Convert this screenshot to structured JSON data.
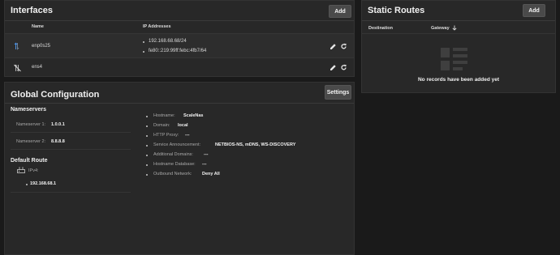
{
  "interfaces": {
    "title": "Interfaces",
    "add_label": "Add",
    "columns": {
      "name": "Name",
      "ip": "IP Addresses"
    },
    "rows": [
      {
        "name": "enp0s25",
        "ips": [
          "192.168.68.68/24",
          "fe80::219:99ff:febc:4fb7/64"
        ]
      },
      {
        "name": "ens4",
        "ips": []
      }
    ]
  },
  "static_routes": {
    "title": "Static Routes",
    "add_label": "Add",
    "columns": {
      "destination": "Destination",
      "gateway": "Gateway"
    },
    "sort_icon": "arrow-down-icon",
    "empty_message": "No records have been added yet"
  },
  "global_config": {
    "title": "Global Configuration",
    "settings_label": "Settings",
    "nameservers": {
      "heading": "Nameservers",
      "items": [
        {
          "label": "Nameserver 1:",
          "value": "1.0.0.1"
        },
        {
          "label": "Nameserver 2:",
          "value": "8.8.8.8"
        }
      ]
    },
    "default_route": {
      "heading": "Default Route",
      "ipv4_label": "IPv4:",
      "ipv4_value": "192.168.68.1"
    },
    "details": [
      {
        "label": "Hostname:",
        "value": "ScaleNas"
      },
      {
        "label": "Domain:",
        "value": "local"
      },
      {
        "label": "HTTP Proxy:",
        "value": "---"
      },
      {
        "label": "Service Announcement:",
        "value": "NETBIOS-NS, mDNS, WS-DISCOVERY"
      },
      {
        "label": "Additional Domains:",
        "value": "---"
      },
      {
        "label": "Hostname Database:",
        "value": "---"
      },
      {
        "label": "Outbound Network:",
        "value": "Deny All"
      }
    ]
  },
  "colors": {
    "background": "#1a1a1a",
    "card": "#282828",
    "button": "#4a4a4a",
    "link_up": "#4a90e2"
  }
}
